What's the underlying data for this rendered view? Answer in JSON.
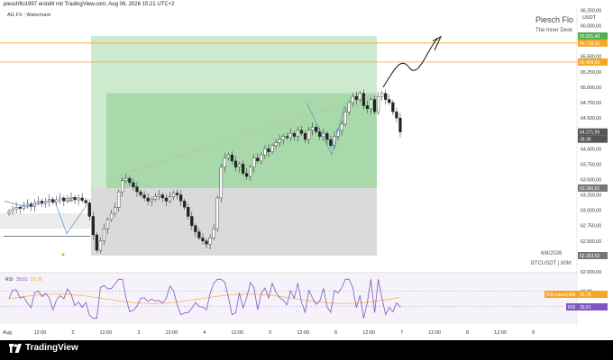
{
  "header": {
    "caption": "pieschflo1997 erstellt mit TradingView.com, Aug 06, 2026 15:21 UTC+2"
  },
  "chart_title": {
    "subtitle": "AG FX - Watermark",
    "author": "Piesch Flo",
    "desk": "The Inner Desk",
    "date_stamp": "6/8/2026",
    "symbol_timeframe": "BTCUSDT | 60M"
  },
  "price_axis": {
    "currency": "USDT",
    "ticks": [
      "66.250,00",
      "66.000,00",
      "65.750,00",
      "65.500,00",
      "65.250,00",
      "65.000,00",
      "64.750,00",
      "64.500,00",
      "64.250,00",
      "64.000,00",
      "63.750,00",
      "63.500,00",
      "63.250,00",
      "63.000,00",
      "62.750,00",
      "62.500,00",
      "62.250,00",
      "62.000,00"
    ],
    "labels": [
      {
        "text": "65.831,49",
        "color": "#4caf50"
      },
      {
        "text": "65.718,00",
        "color": "#f5a623"
      },
      {
        "text": "65.409,56",
        "color": "#f5a623"
      },
      {
        "text": "64.271,99",
        "color": "#555555"
      },
      {
        "text": "28:39",
        "color": "#555555"
      },
      {
        "text": "63.360,62",
        "color": "#777777"
      },
      {
        "text": "62.263,52",
        "color": "#777777"
      }
    ]
  },
  "rsi_panel": {
    "legend_name": "RSI",
    "legend_value": "39,61",
    "legend_ma": "55,78",
    "ticks": [
      "60,00",
      "40,00"
    ],
    "label_ma_name": "RSI-based MA",
    "label_ma_value": "55,78",
    "label_rsi_name": "RSI",
    "label_rsi_value": "39,61"
  },
  "time_axis": {
    "ticks": [
      "Aug",
      "12:00",
      "2",
      "12:00",
      "3",
      "12:00",
      "4",
      "12:00",
      "5",
      "12:00",
      "6",
      "12:00",
      "7",
      "12:00",
      "8",
      "12:00",
      "9"
    ]
  },
  "annotations": {
    "small_label": "W3"
  },
  "brand": {
    "name": "TradingView"
  },
  "colors": {
    "long_box": "#4caf50",
    "short_box": "#9e9e9e",
    "resistance": "#f5a623",
    "rsi_line": "#7e57c2",
    "rsi_ma": "#f5a623"
  },
  "chart_data": {
    "type": "candlestick",
    "title": "",
    "y_unit": "USDT",
    "ylim": [
      62000,
      66300
    ],
    "x_range_hours": [
      0,
      204
    ],
    "x_tick_hours": [
      0,
      12,
      24,
      36,
      48,
      60,
      72,
      84,
      96,
      108,
      120,
      132,
      144,
      156,
      168,
      180,
      192
    ],
    "closes": [
      62980,
      63020,
      63050,
      63030,
      63080,
      63100,
      63060,
      63120,
      63150,
      63110,
      63140,
      63180,
      63130,
      63170,
      63200,
      63150,
      63190,
      63210,
      63170,
      63200,
      63160,
      63120,
      62900,
      62600,
      62350,
      62500,
      62700,
      62850,
      62950,
      63050,
      63300,
      63480,
      63520,
      63450,
      63380,
      63300,
      63250,
      63200,
      63150,
      63180,
      63220,
      63250,
      63200,
      63150,
      63220,
      63280,
      63250,
      63150,
      63050,
      62900,
      62750,
      62650,
      62550,
      62500,
      62450,
      62550,
      62700,
      63200,
      63700,
      63850,
      63900,
      63800,
      63700,
      63750,
      63600,
      63550,
      63700,
      63850,
      63800,
      63900,
      64000,
      63950,
      64050,
      64100,
      64150,
      64200,
      64180,
      64250,
      64200,
      64300,
      64250,
      64150,
      64300,
      64350,
      64280,
      64200,
      64250,
      64150,
      64050,
      64200,
      64300,
      64400,
      64600,
      64750,
      64850,
      64800,
      64900,
      64700,
      64650,
      64800,
      64600,
      64850,
      64900,
      64800,
      64750,
      64600,
      64500,
      64271.99
    ],
    "long_position": {
      "entry": 63360.62,
      "take_profit": 65831.49,
      "stop": 62263.52
    },
    "levels": [
      65718.0,
      65409.56
    ],
    "rsi": {
      "last": 39.61,
      "ma": 55.78,
      "ylim": [
        20,
        80
      ]
    }
  }
}
